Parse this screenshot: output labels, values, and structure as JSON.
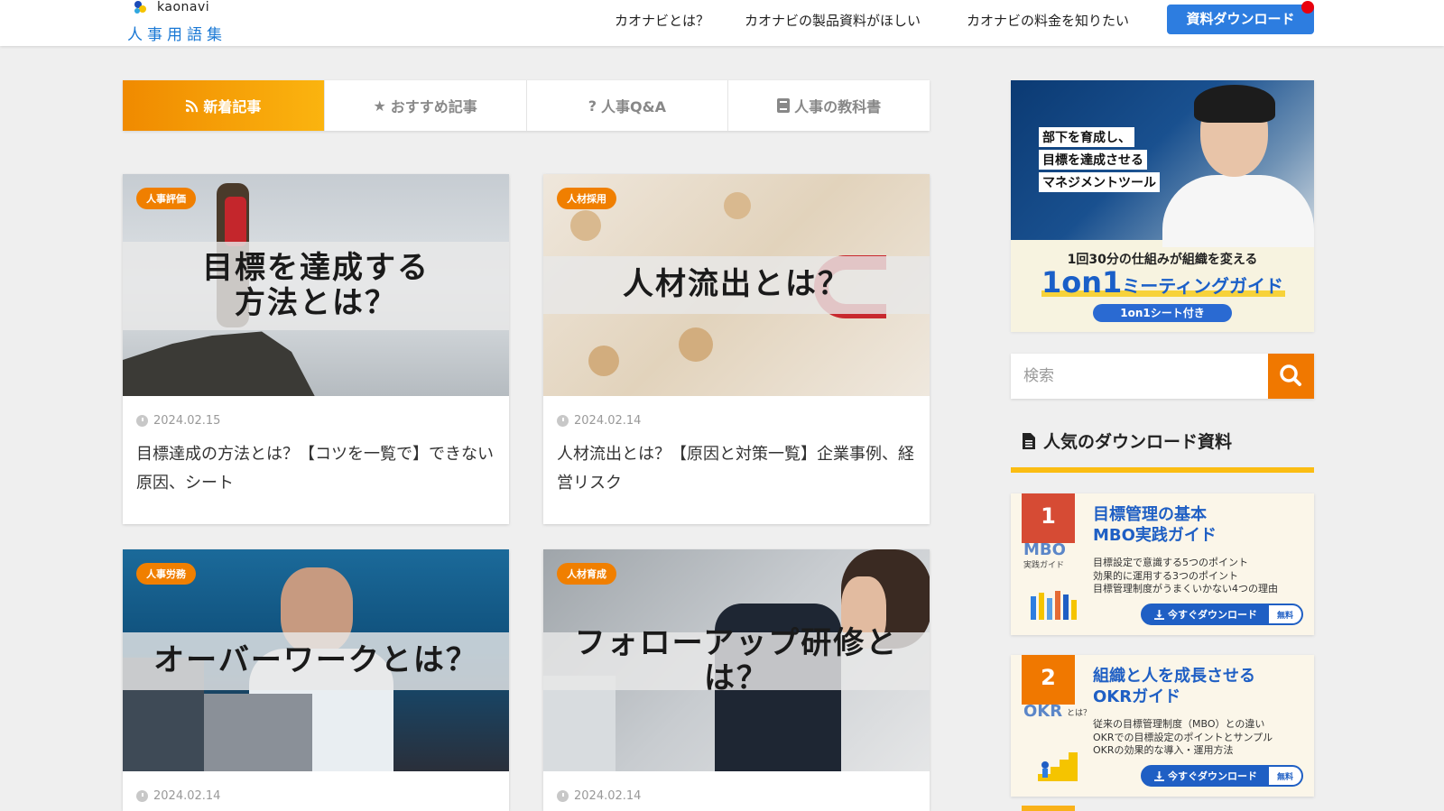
{
  "header": {
    "logo_brand": "kaonavi",
    "logo_sub": "人事用語集",
    "nav": [
      "カオナビとは？",
      "カオナビの製品資料がほしい",
      "カオナビの料金を知りたい"
    ],
    "download_button": "資料ダウンロード"
  },
  "tabs": [
    {
      "label": "新着記事",
      "icon": "rss-icon",
      "active": true
    },
    {
      "label": "おすすめ記事",
      "icon": "star-icon",
      "active": false
    },
    {
      "label": "人事Q&A",
      "icon": "question-icon",
      "active": false
    },
    {
      "label": "人事の教科書",
      "icon": "book-icon",
      "active": false
    }
  ],
  "articles": [
    {
      "category": "人事評価",
      "thumb_text": "目標を達成する\n方法とは？",
      "date": "2024.02.15",
      "title": "目標達成の方法とは？【コツを一覧で】できない原因、シート"
    },
    {
      "category": "人材採用",
      "thumb_text": "人材流出とは？",
      "date": "2024.02.14",
      "title": "人材流出とは？【原因と対策一覧】企業事例、経営リスク"
    },
    {
      "category": "人事労務",
      "thumb_text": "オーバーワークとは？",
      "date": "2024.02.14",
      "title": ""
    },
    {
      "category": "人材育成",
      "thumb_text": "フォローアップ研修とは？",
      "date": "2024.02.14",
      "title": ""
    }
  ],
  "promo": {
    "lines": [
      "部下を育成し、",
      "目標を達成させる",
      "マネジメントツール"
    ],
    "sub": "1回30分の仕組みが組織を変える",
    "big_1": "1on1",
    "big_2": "ミーティングガイド",
    "pill": "1on1シート付き"
  },
  "search": {
    "placeholder": "検索"
  },
  "popular": {
    "heading": "人気のダウンロード資料",
    "items": [
      {
        "rank": "1",
        "short": "MBO",
        "short_sub": "実践ガイド",
        "title_1": "目標管理の基本",
        "title_2": "MBO実践ガイド",
        "bullets": [
          "目標設定で意識する5つのポイント",
          "効果的に運用する3つのポイント",
          "目標管理制度がうまくいかない4つの理由"
        ],
        "cta": "今すぐダウンロード",
        "free": "無料"
      },
      {
        "rank": "2",
        "short": "OKR",
        "short_sub": "とは？",
        "title_1": "組織と人を成長させる",
        "title_2": "OKRガイド",
        "bullets": [
          "従来の目標管理制度（MBO）との違い",
          "OKRでの目標設定のポイントとサンプル",
          "OKRの効果的な導入・運用方法"
        ],
        "cta": "今すぐダウンロード",
        "free": "無料"
      }
    ]
  },
  "colors": {
    "accent_orange": "#f07f00",
    "brand_blue": "#1a78d4",
    "button_blue": "#2d7de0",
    "yellow": "#fbbd13"
  }
}
